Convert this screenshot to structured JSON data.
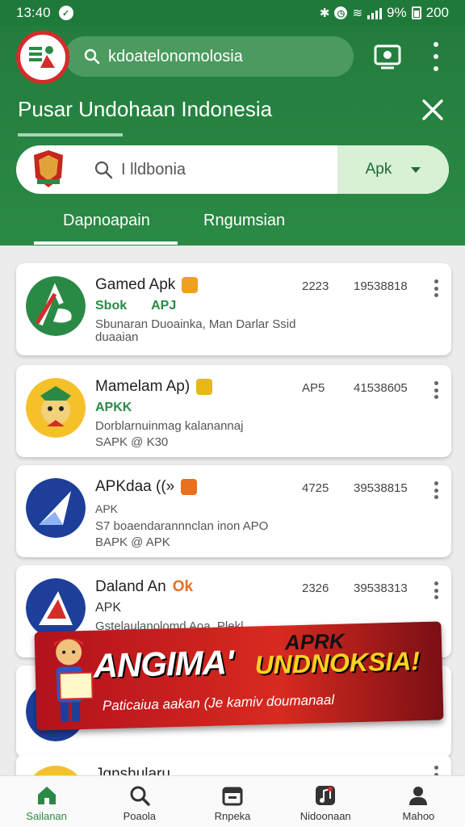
{
  "status_bar": {
    "time": "13:40",
    "battery": "9%",
    "extra": "200"
  },
  "header": {
    "search_query": "kdoatelonomolosia",
    "title": "Pusar Undohaan Indonesia"
  },
  "search": {
    "query": "I lldbonia",
    "filter_label": "Apk"
  },
  "tabs": [
    {
      "label": "Dapnoapain",
      "active": true
    },
    {
      "label": "Rngumsian",
      "active": false
    }
  ],
  "apps": [
    {
      "name": "Gamed Apk",
      "sub": "Sbok",
      "sub2": "APJ",
      "desc1": "Sbunaran Duoainka, Man Darlar Ssid",
      "desc2": "duaaian",
      "num1": "2223",
      "num2": "19538818"
    },
    {
      "name": "Mamelam Ap)",
      "sub": "APKK",
      "sub2": "",
      "desc1": "Dorblarnuinmag kalanannaj",
      "desc2": "SAPK @ K30",
      "num1": "AP5",
      "num2": "41538605"
    },
    {
      "name": "APKdaa ((»",
      "sub": "APK",
      "sub2": "",
      "desc1": "S7 boaendarannnclan inon APO",
      "desc2": "BAPK @ APK",
      "num1": "4725",
      "num2": "39538815"
    },
    {
      "name": "Daland An",
      "sub": "APK",
      "sub2": "",
      "badge": "Ok",
      "desc1": "Gstelaulanolomd Aoa, Plekl",
      "desc2": "",
      "num1": "2326",
      "num2": "39538313"
    },
    {
      "name": "",
      "sub": "",
      "sub2": "",
      "desc1": "",
      "desc2": "",
      "num1": "",
      "num2": ""
    },
    {
      "name": "Jgnshularu",
      "sub": "",
      "sub2": "",
      "desc1": "",
      "desc2": "",
      "num1": "",
      "num2": ""
    }
  ],
  "banner": {
    "word1": "ANGIMA'",
    "word2": "APRK",
    "word3": "UNDNOKSIA!",
    "tagline": "Paticaiua aakan (Je kamiv doumanaal"
  },
  "bottom_nav": [
    {
      "label": "Sailanan",
      "icon": "home-icon",
      "active": true
    },
    {
      "label": "Poaola",
      "icon": "search-icon",
      "active": false
    },
    {
      "label": "Rnpeka",
      "icon": "calendar-icon",
      "active": false
    },
    {
      "label": "Nidoonaan",
      "icon": "music-icon",
      "active": false
    },
    {
      "label": "Mahoo",
      "icon": "profile-icon",
      "active": false
    }
  ],
  "colors": {
    "primary_green": "#247c3d",
    "accent_red": "#d62b2b",
    "banner_yellow": "#ffd21f"
  }
}
